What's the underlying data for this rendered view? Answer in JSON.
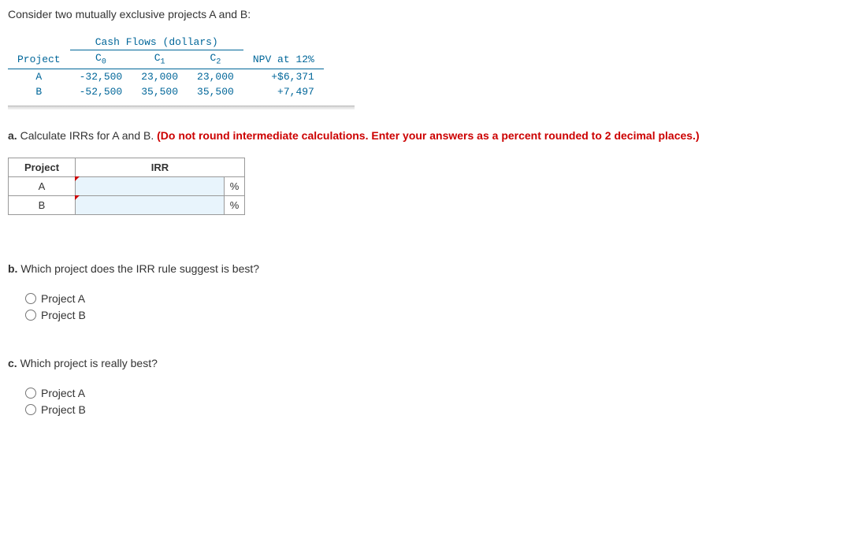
{
  "intro": "Consider two mutually exclusive projects A and B:",
  "cashFlowHeader": "Cash Flows (dollars)",
  "cols": {
    "project": "Project",
    "c0": "C",
    "c0sub": "0",
    "c1": "C",
    "c1sub": "1",
    "c2": "C",
    "c2sub": "2",
    "npv": "NPV at 12%"
  },
  "rows": {
    "a": {
      "name": "A",
      "c0": "-32,500",
      "c1": "23,000",
      "c2": "23,000",
      "npv": "+$6,371"
    },
    "b": {
      "name": "B",
      "c0": "-52,500",
      "c1": "35,500",
      "c2": "35,500",
      "npv": "+7,497"
    }
  },
  "qa": {
    "prefix": "a. ",
    "text": "Calculate IRRs for A and B. ",
    "red": "(Do not round intermediate calculations. Enter  your answers as a percent rounded to 2 decimal places.)"
  },
  "inputTable": {
    "h1": "Project",
    "h2": "IRR",
    "rA": "A",
    "rB": "B",
    "pct": "%"
  },
  "qb": {
    "prefix": "b. ",
    "text": "Which project does the IRR rule suggest is best?"
  },
  "qc": {
    "prefix": "c. ",
    "text": "Which project is really best?"
  },
  "options": {
    "a": "Project A",
    "b": "Project B"
  }
}
